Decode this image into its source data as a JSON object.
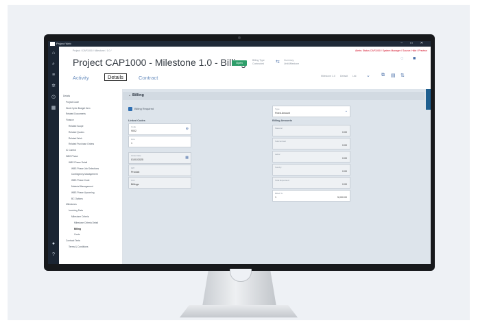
{
  "app": {
    "name": "Project Web",
    "window_controls": "– □ ✕"
  },
  "nav_icons": [
    "home-icon",
    "search-icon",
    "list-icon",
    "gear-icon",
    "clock-icon",
    "grid-icon",
    "user-icon",
    "help-icon"
  ],
  "header": {
    "breadcrumb": "Project / CAP1000 / Milestone / 1.0 /",
    "alert": "Alerts: Status CAP1000 / System Manager / Source: Hide / Preview",
    "title": "Project CAP1000 - Milestone 1.0 - Billing",
    "status_badge": "Open",
    "info_1_label": "Billing Type",
    "info_1_value": "Contracted",
    "info_2_label": "Currency",
    "info_2_value": "Unit/Milestone",
    "milestone_label": "Milestone 1.0",
    "sort_label": "Default",
    "sort_value": "List"
  },
  "tabs": [
    {
      "label": "Activity"
    },
    {
      "label": "Details"
    },
    {
      "label": "Contract"
    }
  ],
  "sidebar": {
    "items": [
      {
        "label": "Details",
        "indent": 0
      },
      {
        "label": "Project Code",
        "indent": 1
      },
      {
        "label": "Work Cycle Budget Item",
        "indent": 1
      },
      {
        "label": "Related Documents",
        "indent": 1
      },
      {
        "label": "Finance",
        "indent": 1
      },
      {
        "label": "Related Scope",
        "indent": 2
      },
      {
        "label": "Related Quotes",
        "indent": 2
      },
      {
        "label": "Related Work",
        "indent": 2
      },
      {
        "label": "Related Purchase Orders",
        "indent": 2
      },
      {
        "label": "IC Control",
        "indent": 1
      },
      {
        "label": "WBS Phase",
        "indent": 1
      },
      {
        "label": "WBS Phase Detail",
        "indent": 2
      },
      {
        "label": "WBS Phase Job Selections",
        "indent": 3
      },
      {
        "label": "Contingency Management",
        "indent": 3
      },
      {
        "label": "WBS Phase Code",
        "indent": 3
      },
      {
        "label": "Material Management",
        "indent": 3
      },
      {
        "label": "WBS Phase Upcoming",
        "indent": 3
      },
      {
        "label": "BC Options",
        "indent": 3
      },
      {
        "label": "Milestones",
        "indent": 1
      },
      {
        "label": "Invoicing Data",
        "indent": 2
      },
      {
        "label": "Milestone Criteria",
        "indent": 3
      },
      {
        "label": "Milestone Criteria Detail",
        "indent": 4
      },
      {
        "label": "Billing",
        "indent": 4
      },
      {
        "label": "Costs",
        "indent": 4
      },
      {
        "label": "Contract Texts",
        "indent": 1
      },
      {
        "label": "Terms & Conditions",
        "indent": 2
      }
    ]
  },
  "billing": {
    "section_title": "Billing",
    "checkbox_label": "Billing Required",
    "type_label": "Type",
    "type_value": "Fixed Amount",
    "left_group_title": "Linked Codes",
    "left_fields": [
      {
        "label": "Code",
        "value": "9002"
      },
      {
        "label": "Line",
        "value": "1"
      },
      {
        "label": "Order Date",
        "value": "01/01/2025"
      },
      {
        "label": "GPI",
        "value": "Product"
      },
      {
        "label": "Unit",
        "value": "Billings"
      }
    ],
    "right_group_title": "Billing Amounts",
    "right_fields": [
      {
        "label": "Material",
        "value": "0.00"
      },
      {
        "label": "Subcontract",
        "value": "0.00"
      },
      {
        "label": "Labor",
        "value": "0.00"
      },
      {
        "label": "Sundry",
        "value": "0.00"
      },
      {
        "label": "Total Expensed",
        "value": "0.00"
      },
      {
        "label": "Billed To",
        "value": "1",
        "amount": "5,000.00"
      }
    ]
  },
  "colors": {
    "accent": "#2f6fb2",
    "badge": "#2e9e6a",
    "alert": "#d0021b",
    "nav": "#1b2533"
  }
}
